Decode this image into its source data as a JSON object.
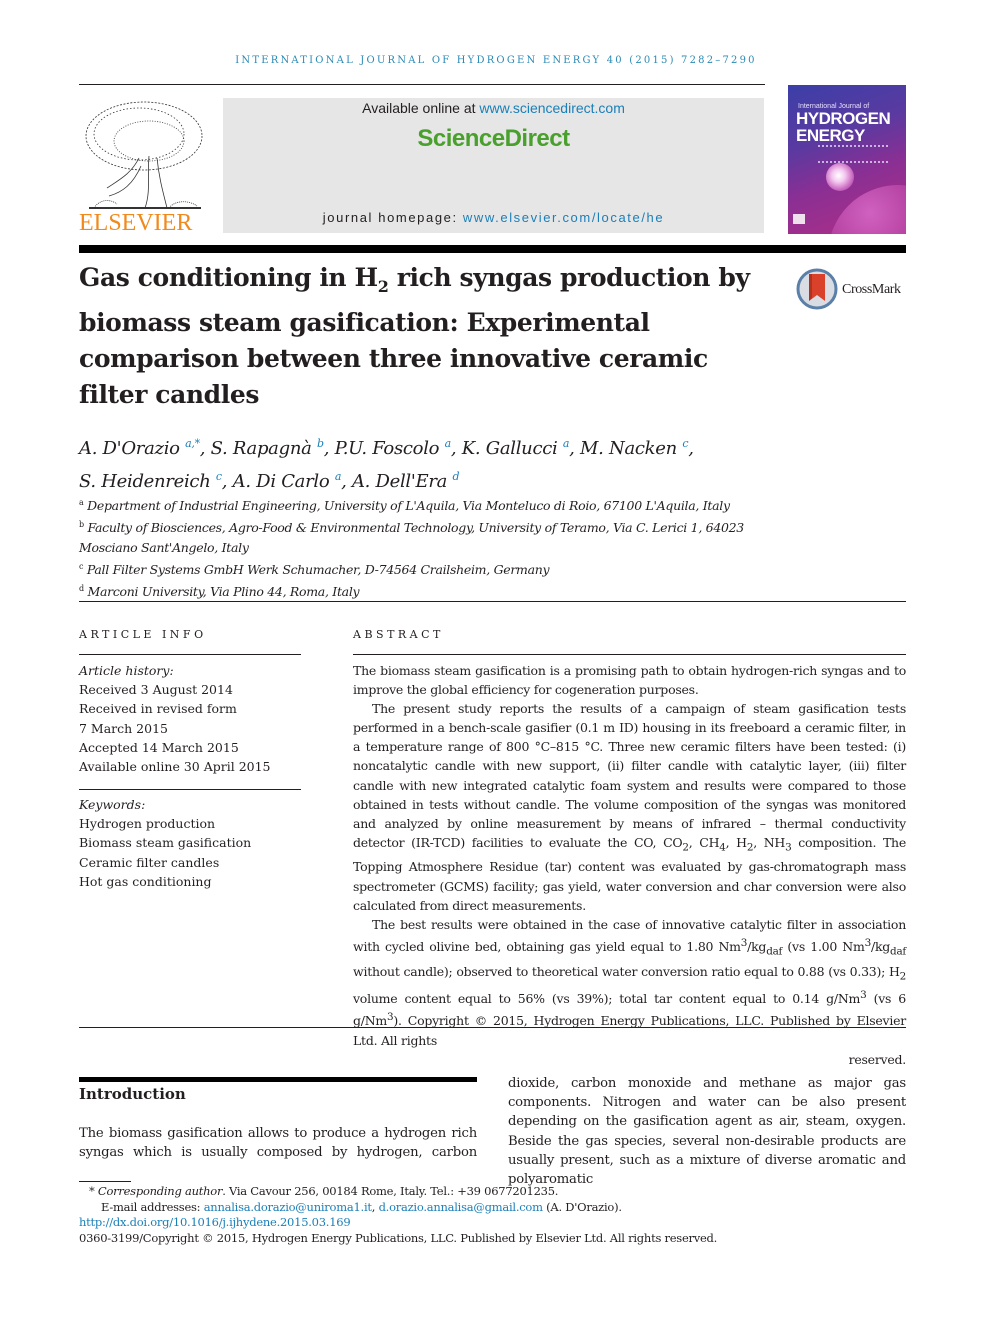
{
  "header": {
    "journal_line": "INTERNATIONAL JOURNAL OF HYDROGEN ENERGY 40 (2015) 7282–7290",
    "publisher": "ELSEVIER",
    "available_prefix": "Available online at ",
    "available_link": "www.sciencedirect.com",
    "brand": "ScienceDirect",
    "homepage_prefix": "journal homepage: ",
    "homepage_link": "www.elsevier.com/locate/he",
    "cover": {
      "line1": "International Journal of",
      "line2": "HYDROGEN",
      "line3": "ENERGY"
    },
    "crossmark_label": "CrossMark"
  },
  "article": {
    "title_part1": "Gas conditioning in H",
    "title_sub": "2",
    "title_part2": " rich syngas production by biomass steam gasification: Experimental comparison between three innovative ceramic filter candles",
    "authors": [
      {
        "name": "A. D'Orazio",
        "aff": "a,*"
      },
      {
        "name": "S. Rapagnà",
        "aff": "b"
      },
      {
        "name": "P.U. Foscolo",
        "aff": "a"
      },
      {
        "name": "K. Gallucci",
        "aff": "a"
      },
      {
        "name": "M. Nacken",
        "aff": "c"
      },
      {
        "name": "S. Heidenreich",
        "aff": "c"
      },
      {
        "name": "A. Di Carlo",
        "aff": "a"
      },
      {
        "name": "A. Dell'Era",
        "aff": "d"
      }
    ],
    "affiliations": [
      {
        "key": "a",
        "text": "Department of Industrial Engineering, University of L'Aquila, Via Monteluco di Roio, 67100 L'Aquila, Italy"
      },
      {
        "key": "b",
        "text": "Faculty of Biosciences, Agro-Food & Environmental Technology, University of Teramo, Via C. Lerici 1, 64023 Mosciano Sant'Angelo, Italy"
      },
      {
        "key": "c",
        "text": "Pall Filter Systems GmbH Werk Schumacher, D-74564 Crailsheim, Germany"
      },
      {
        "key": "d",
        "text": "Marconi University, Via Plino 44, Roma, Italy"
      }
    ]
  },
  "article_info": {
    "heading": "ARTICLE INFO",
    "history_label": "Article history:",
    "history": [
      "Received 3 August 2014",
      "Received in revised form",
      "7 March 2015",
      "Accepted 14 March 2015",
      "Available online 30 April 2015"
    ],
    "keywords_label": "Keywords:",
    "keywords": [
      "Hydrogen production",
      "Biomass steam gasification",
      "Ceramic filter candles",
      "Hot gas conditioning"
    ]
  },
  "abstract": {
    "heading": "ABSTRACT",
    "p1": "The biomass steam gasification is a promising path to obtain hydrogen-rich syngas and to improve the global efficiency for cogeneration purposes.",
    "p2a": "The present study reports the results of a campaign of steam gasification tests performed in a bench-scale gasifier (0.1 m ID) housing in its freeboard a ceramic filter, in a temperature range of 800 °C–815 °C. Three new ceramic filters have been tested: (i) noncatalytic candle with new support, (ii) filter candle with catalytic layer, (iii) filter candle with new integrated catalytic foam system and results were compared to those obtained in tests without candle. The volume composition of the syngas was monitored and analyzed by online measurement by means of infrared – thermal conductivity detector (IR-TCD) facilities to evaluate the CO, CO",
    "p2b": ", CH",
    "p2c": ", H",
    "p2d": ", NH",
    "p2e": " composition. The Topping Atmosphere Residue (tar) content was evaluated by gas-chromatograph mass spectrometer (GCMS) facility; gas yield, water conversion and char conversion were also calculated from direct measurements.",
    "p3a": "The best results were obtained in the case of innovative catalytic filter in association with cycled olivine bed, obtaining gas yield equal to 1.80 Nm",
    "p3b": "/kg",
    "p3c": " (vs 1.00 Nm",
    "p3d": "/kg",
    "p3e": " without candle); observed to theoretical water conversion ratio equal to 0.88 (vs 0.33); H",
    "p3f": " volume content equal to 56% (vs 39%); total tar content equal to 0.14 g/Nm",
    "p3g": " (vs 6 g/Nm",
    "p3h": ").",
    "copyright": "Copyright © 2015, Hydrogen Energy Publications, LLC. Published by Elsevier Ltd. All rights",
    "reserved": "reserved.",
    "sub2": "2",
    "sub3": "3",
    "sub4": "4",
    "sup3": "3",
    "daf": "daf"
  },
  "introduction": {
    "heading": "Introduction",
    "left": "The biomass gasification allows to produce a hydrogen rich syngas which is usually composed by hydrogen, carbon",
    "right": "dioxide, carbon monoxide and methane as major gas components. Nitrogen and water can be also present depending on the gasification agent as air, steam, oxygen. Beside the gas species, several non-desirable products are usually present, such as a mixture of diverse aromatic and polyaromatic"
  },
  "footnotes": {
    "star": "*",
    "corr_label": "Corresponding author",
    "corr_text": ". Via Cavour 256, 00184 Rome, Italy. Tel.: +39 0677201235.",
    "email_label": "E-mail addresses: ",
    "email1": "annalisa.dorazio@uniroma1.it",
    "sep": ", ",
    "email2": "d.orazio.annalisa@gmail.com",
    "email_suffix": " (A. D'Orazio).",
    "doi": "http://dx.doi.org/10.1016/j.ijhydene.2015.03.169",
    "copyright": "0360-3199/Copyright © 2015, Hydrogen Energy Publications, LLC. Published by Elsevier Ltd. All rights reserved."
  }
}
